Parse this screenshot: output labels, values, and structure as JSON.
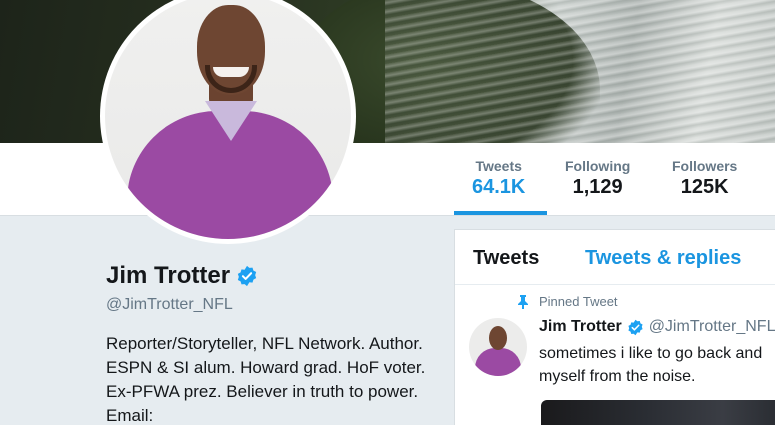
{
  "profile": {
    "name": "Jim Trotter",
    "handle": "@JimTrotter_NFL",
    "bio": "Reporter/Storyteller, NFL Network. Author. ESPN & SI alum. Howard grad. HoF voter. Ex-PFWA prez. Believer in truth to power. Email:"
  },
  "stats": [
    {
      "label": "Tweets",
      "value": "64.1K"
    },
    {
      "label": "Following",
      "value": "1,129"
    },
    {
      "label": "Followers",
      "value": "125K"
    }
  ],
  "timeline": {
    "tabs": [
      "Tweets",
      "Tweets & replies"
    ],
    "pinned_label": "Pinned Tweet",
    "tweet": {
      "name": "Jim Trotter",
      "handle": "@JimTrotter_NFL",
      "text_line1": "sometimes i like to go back and",
      "text_line2": "myself from the noise."
    }
  },
  "colors": {
    "accent": "#1b95e0",
    "secondary_text": "#657786",
    "background": "#e6ecf0"
  }
}
